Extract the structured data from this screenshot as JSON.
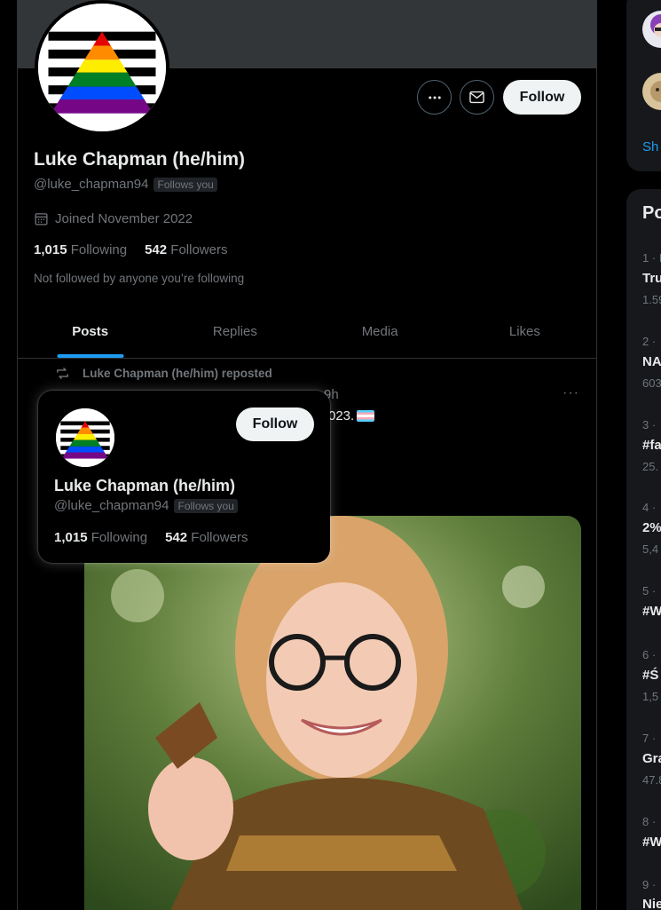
{
  "profile": {
    "name": "Luke Chapman (he/him)",
    "handle": "@luke_chapman94",
    "follows_you_badge": "Follows you",
    "joined": "Joined November 2022",
    "following_count": "1,015",
    "following_label": "Following",
    "followers_count": "542",
    "followers_label": "Followers",
    "not_followed_note": "Not followed by anyone you’re following",
    "follow_button": "Follow",
    "more_icon": "more-horizontal-icon",
    "message_icon": "envelope-icon"
  },
  "tabs": [
    {
      "label": "Posts",
      "active": true
    },
    {
      "label": "Replies",
      "active": false
    },
    {
      "label": "Media",
      "active": false
    },
    {
      "label": "Likes",
      "active": false
    }
  ],
  "post": {
    "repost_label": "Luke Chapman (he/him) reposted",
    "time": "9h",
    "text_fragment": "023.",
    "more": "···"
  },
  "hovercard": {
    "name": "Luke Chapman (he/him)",
    "handle": "@luke_chapman94",
    "follows_you_badge": "Follows you",
    "following_count": "1,015",
    "following_label": "Following",
    "followers_count": "542",
    "followers_label": "Followers",
    "follow_button": "Follow"
  },
  "sidebar": {
    "show_more": "Sh",
    "trends_title": "Po",
    "trends": [
      {
        "num": "1 · I",
        "name": "Tru",
        "count": "1.59"
      },
      {
        "num": "2 ·",
        "name": "NA",
        "count": "603"
      },
      {
        "num": "3 ·",
        "name": "#fa",
        "count": "25."
      },
      {
        "num": "4 ·",
        "name": "2%",
        "count": "5,4"
      },
      {
        "num": "5 ·",
        "name": "#W",
        "count": ""
      },
      {
        "num": "6 ·",
        "name": "#Ś",
        "count": "1,5"
      },
      {
        "num": "7 ·",
        "name": "Gra",
        "count": "47.8"
      },
      {
        "num": "8 ·",
        "name": "#W",
        "count": ""
      },
      {
        "num": "9 ·",
        "name": "Nie",
        "count": ""
      }
    ]
  },
  "colors": {
    "accent": "#1d9bf0",
    "background": "#000000",
    "muted_text": "#71767b",
    "border": "#2f3336"
  }
}
